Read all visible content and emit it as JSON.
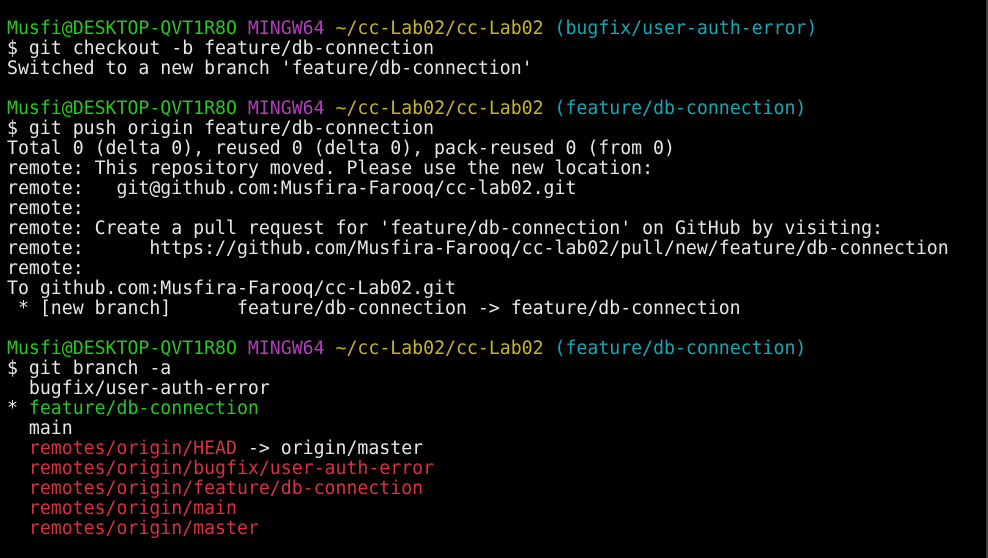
{
  "colors": {
    "background": "#000000",
    "text": "#e6e6e6",
    "user_host": "#23c823",
    "shell_name": "#b43cbe",
    "path": "#c8b428",
    "branch": "#16a7b6",
    "remote_branch": "#d9313f",
    "current_branch": "#23c823"
  },
  "prompts": [
    {
      "user_host": "Musfi@DESKTOP-QVT1R8O",
      "shell": "MINGW64",
      "path": "~/cc-Lab02/cc-Lab02",
      "branch": "(bugfix/user-auth-error)",
      "command": "$ git checkout -b feature/db-connection"
    },
    {
      "user_host": "Musfi@DESKTOP-QVT1R8O",
      "shell": "MINGW64",
      "path": "~/cc-Lab02/cc-Lab02",
      "branch": "(feature/db-connection)",
      "command": "$ git push origin feature/db-connection"
    },
    {
      "user_host": "Musfi@DESKTOP-QVT1R8O",
      "shell": "MINGW64",
      "path": "~/cc-Lab02/cc-Lab02",
      "branch": "(feature/db-connection)",
      "command": "$ git branch -a"
    }
  ],
  "output_checkout": [
    "Switched to a new branch 'feature/db-connection'"
  ],
  "output_push": [
    "Total 0 (delta 0), reused 0 (delta 0), pack-reused 0 (from 0)",
    "remote: This repository moved. Please use the new location:",
    "remote:   git@github.com:Musfira-Farooq/cc-lab02.git",
    "remote:",
    "remote: Create a pull request for 'feature/db-connection' on GitHub by visiting:",
    "remote:      https://github.com/Musfira-Farooq/cc-lab02/pull/new/feature/db-connection",
    "remote:",
    "To github.com:Musfira-Farooq/cc-Lab02.git",
    " * [new branch]      feature/db-connection -> feature/db-connection"
  ],
  "branch_list": {
    "local_other_1": "  bugfix/user-auth-error",
    "current_marker": "* ",
    "current": "feature/db-connection",
    "local_other_2": "  main",
    "remote_head": "remotes/origin/HEAD",
    "remote_head_arrow": " -> origin/master",
    "remotes": [
      "remotes/origin/bugfix/user-auth-error",
      "remotes/origin/feature/db-connection",
      "remotes/origin/main",
      "remotes/origin/master"
    ],
    "indent": "  "
  }
}
